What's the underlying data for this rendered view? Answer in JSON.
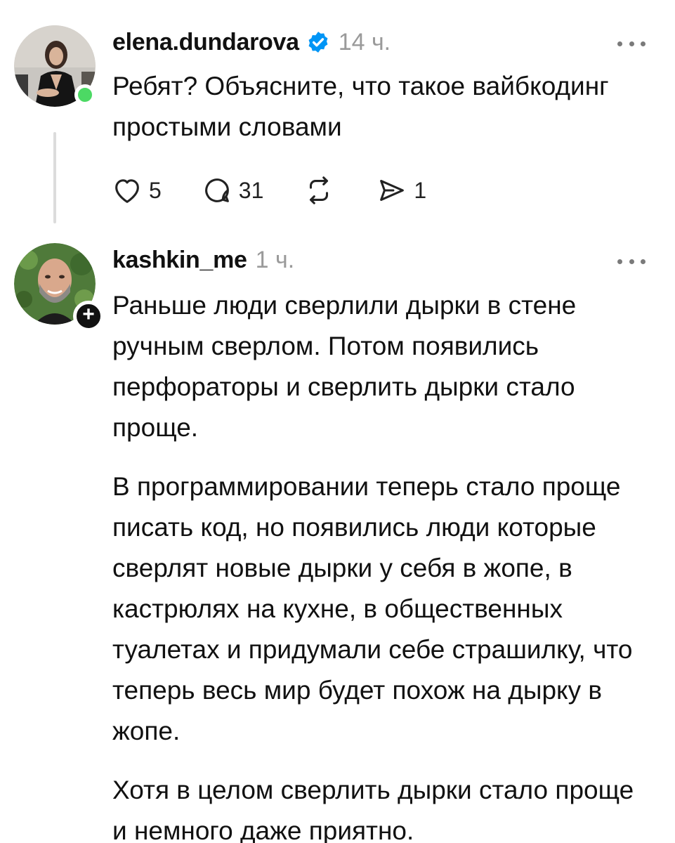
{
  "posts": [
    {
      "username": "elena.dundarova",
      "verified": true,
      "timestamp": "14 ч.",
      "text": [
        "Ребят? Объясните, что такое вайбкодинг простыми словами"
      ],
      "status": "online",
      "actions": {
        "likes": "5",
        "comments": "31",
        "shares": "1"
      }
    },
    {
      "username": "kashkin_me",
      "verified": false,
      "timestamp": "1 ч.",
      "text": [
        "Раньше люди сверлили дырки в стене ручным сверлом. Потом появились перфораторы и сверлить дырки стало проще.",
        "В программировании теперь стало проще писать код, но появились люди которые сверлят новые дырки у себя в жопе, в кастрюлях на кухне, в общественных туалетах и придумали себе страшилку, что теперь весь мир будет похож на дырку в жопе.",
        "Хотя в целом сверлить дырки стало проще и немного даже приятно."
      ],
      "follow_badge": "+"
    }
  ],
  "colors": {
    "verified": "#0095f6",
    "online": "#4cd964",
    "muted": "#9a9a9a",
    "thread_line": "#dcdcdc"
  },
  "icons": [
    "heart-icon",
    "comment-icon",
    "repost-icon",
    "share-icon",
    "more-icon",
    "verified-badge-icon"
  ]
}
